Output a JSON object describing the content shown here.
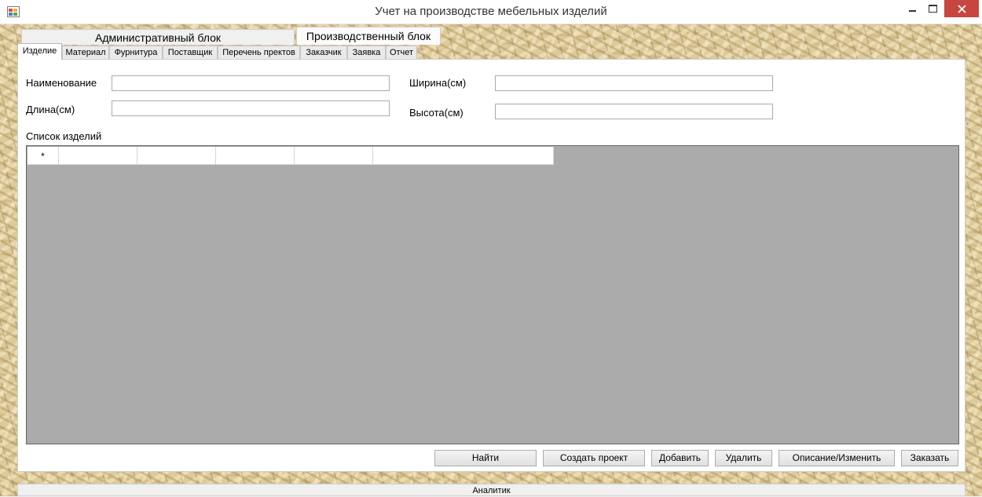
{
  "window": {
    "title": "Учет на производстве мебельных изделий",
    "icon": "app-form-icon",
    "close_color": "#c7463f"
  },
  "block_tabs": {
    "admin": "Административный блок",
    "production": "Производственный блок",
    "analyst": "Аналитик"
  },
  "tabs": [
    {
      "label": "Изделие",
      "active": true
    },
    {
      "label": "Материал"
    },
    {
      "label": "Фурнитура"
    },
    {
      "label": "Поставщик"
    },
    {
      "label": "Перечень пректов"
    },
    {
      "label": "Заказчик"
    },
    {
      "label": "Заявка"
    },
    {
      "label": "Отчет"
    }
  ],
  "form": {
    "name_label": "Наименование",
    "length_label": "Длина(см)",
    "width_label": "Ширина(см)",
    "height_label": "Высота(см)",
    "name_value": "",
    "length_value": "",
    "width_value": "",
    "height_value": ""
  },
  "list": {
    "title": "Список изделий",
    "new_row_marker": "*"
  },
  "buttons": {
    "find": "Найти",
    "create_project": "Создать проект",
    "add": "Добавить",
    "delete": "Удалить",
    "describe_edit": "Описание/Изменить",
    "order": "Заказать"
  }
}
